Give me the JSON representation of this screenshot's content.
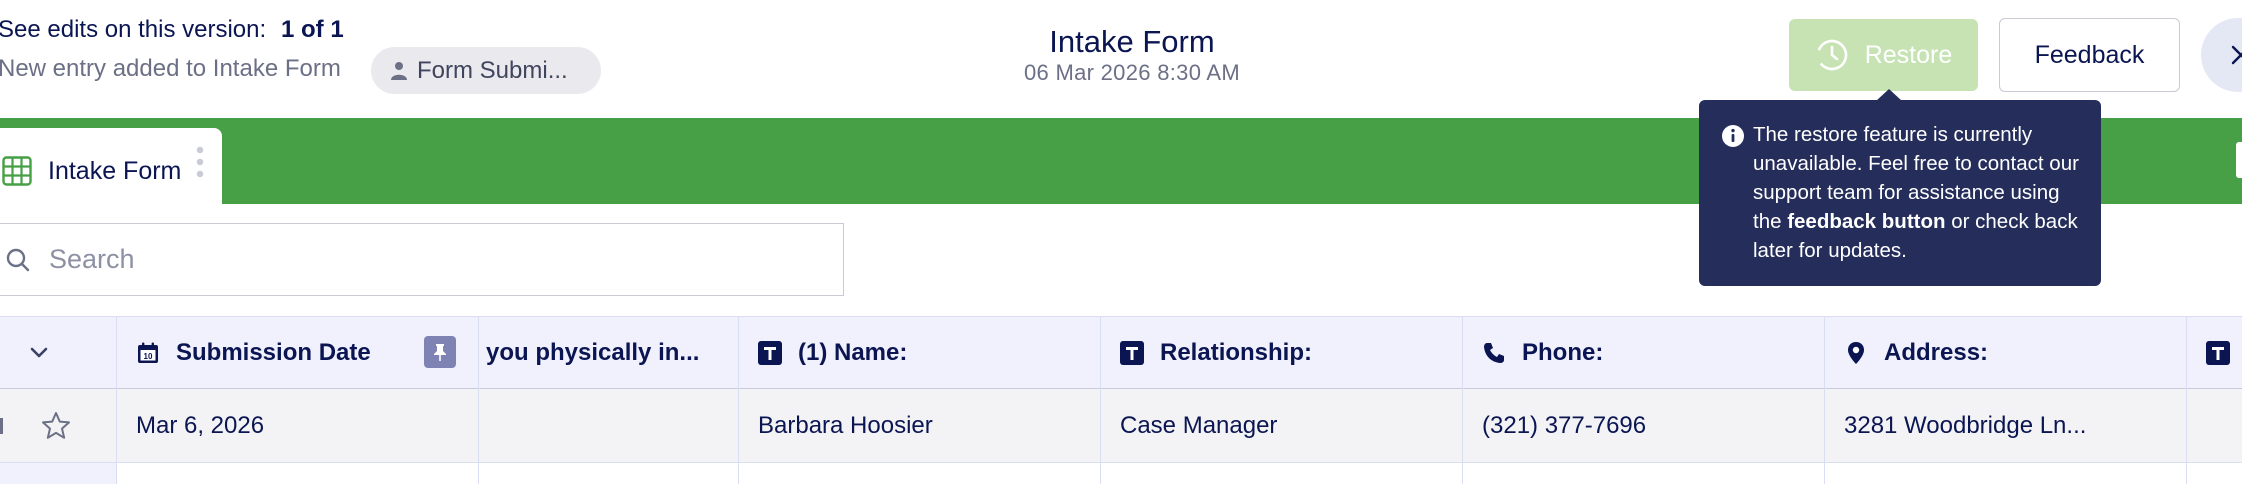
{
  "header": {
    "edits_label": "See edits on this version:",
    "edits_count": "1 of 1",
    "entry_text": "New entry added to Intake Form",
    "submission_chip_label": "Form Submi...",
    "form_title": "Intake Form",
    "version_date": "06 Mar 2026 8:30 AM",
    "restore_label": "Restore",
    "feedback_label": "Feedback"
  },
  "tabs": [
    {
      "label": "Intake Form",
      "icon": "table-grid-icon",
      "active": true
    }
  ],
  "search": {
    "placeholder": "Search",
    "value": ""
  },
  "tooltip": {
    "text_before": "The restore feature is currently unavailable. Feel free to contact our support team for assistance using the",
    "bold_text": "feedback button",
    "text_after": "or check back later for updates."
  },
  "table": {
    "columns": [
      {
        "label": "Submission Date",
        "icon": "calendar-icon"
      },
      {
        "label": "you physically in...",
        "icon": ""
      },
      {
        "label": "(1) Name:",
        "icon": "text-field-icon"
      },
      {
        "label": "Relationship:",
        "icon": "text-field-icon"
      },
      {
        "label": "Phone:",
        "icon": "phone-icon"
      },
      {
        "label": "Address:",
        "icon": "location-pin-icon"
      }
    ],
    "rows": [
      {
        "cells": [
          "Mar 6, 2026",
          "",
          "Barbara Hoosier",
          "Case Manager",
          "(321) 377-7696",
          "3281 Woodbridge Ln..."
        ]
      }
    ]
  },
  "colors": {
    "brand_green": "#479f46",
    "restore_disabled": "#c7e3b4",
    "tooltip_bg": "#252d5b",
    "navy_text": "#0a1551"
  }
}
